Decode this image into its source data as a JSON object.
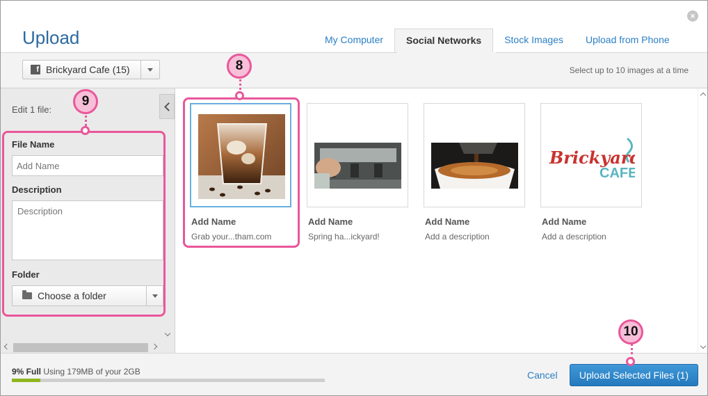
{
  "dialog": {
    "title": "Upload",
    "close_symbol": "×"
  },
  "tabs": [
    {
      "label": "My Computer",
      "active": false
    },
    {
      "label": "Social Networks",
      "active": true
    },
    {
      "label": "Stock Images",
      "active": false
    },
    {
      "label": "Upload from Phone",
      "active": false
    }
  ],
  "toolbar": {
    "account_icon": "facebook-icon",
    "account_glyph": "f",
    "account_label": "Brickyard Cafe (15)",
    "hint": "Select up to 10 images at a time"
  },
  "edit_panel": {
    "heading": "Edit 1 file:",
    "file_name_label": "File Name",
    "file_name_placeholder": "Add Name",
    "description_label": "Description",
    "description_placeholder": "Description",
    "folder_label": "Folder",
    "folder_value": "Choose a folder"
  },
  "images": [
    {
      "name": "Add Name",
      "description": "Grab your...tham.com",
      "selected": true,
      "thumb": "iced-coffee"
    },
    {
      "name": "Add Name",
      "description": "Spring ha...ickyard!",
      "selected": false,
      "thumb": "espresso-machine"
    },
    {
      "name": "Add Name",
      "description": "Add a description",
      "selected": false,
      "thumb": "coffee-cup"
    },
    {
      "name": "Add Name",
      "description": "Add a description",
      "selected": false,
      "thumb": "logo"
    }
  ],
  "logo": {
    "line1": "Brickyard",
    "line2": "CAFE"
  },
  "footer": {
    "storage_percent_label": "9% Full",
    "storage_text": "Using 179MB of your 2GB",
    "storage_fraction": 0.09,
    "cancel_label": "Cancel",
    "upload_label": "Upload Selected Files (1)"
  },
  "callouts": [
    "8",
    "9",
    "10"
  ],
  "colors": {
    "accent_blue": "#2a7fc4",
    "callout_pink": "#e9579a",
    "storage_green": "#8fb51f"
  }
}
